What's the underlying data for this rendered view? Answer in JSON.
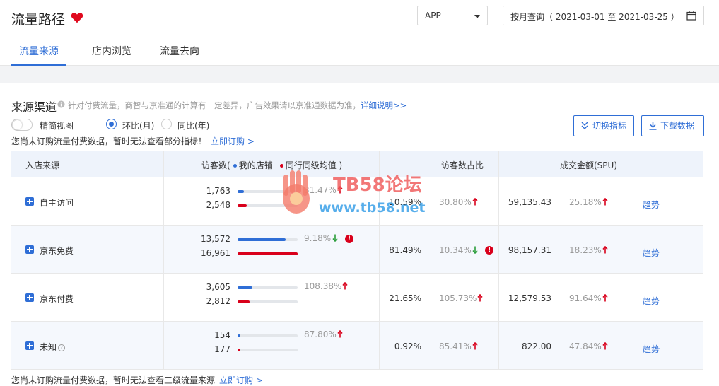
{
  "header": {
    "title": "流量路径",
    "platform_select": "APP",
    "date_range": "按月查询（ 2021-03-01 至 2021-03-25 ）",
    "tabs": [
      "流量来源",
      "店内浏览",
      "流量去向"
    ],
    "active_tab": 0
  },
  "section": {
    "title": "来源渠道",
    "note": "针对付费流量，商智与京准通的计算有一定差异，广告效果请以京准通数据为准，",
    "detail_link": "详细说明>>",
    "options": {
      "simple_view": "精简视图",
      "mom": "环比(月)",
      "yoy": "同比(年)",
      "selected": "mom"
    },
    "warning": "您尚未订购流量付费数据，暂时无法查看部分指标！",
    "subscribe_link": "立即订购 >",
    "buttons": {
      "switch_metric": "切换指标",
      "download": "下载数据"
    }
  },
  "table": {
    "headers": {
      "source": "入店来源",
      "visitors": "访客数(",
      "my_store": "我的店铺",
      "peer_avg": "同行同级均值 )",
      "visitor_share": "访客数占比",
      "gmv": "成交金额(SPU)"
    },
    "rows": [
      {
        "name": "自主访问",
        "help": false,
        "visitors_my": "1,763",
        "visitors_peer": "2,548",
        "bar_my_ratio": 0.104,
        "bar_peer_ratio": 0.15,
        "visitors_change": "31.47%",
        "visitors_dir": "up",
        "visitors_alert": false,
        "share": "10.59%",
        "share_change": "30.80%",
        "share_dir": "up",
        "share_alert": false,
        "gmv": "59,135.43",
        "gmv_change": "25.18%",
        "gmv_dir": "up",
        "trend": "趋势"
      },
      {
        "name": "京东免费",
        "help": false,
        "visitors_my": "13,572",
        "visitors_peer": "16,961",
        "bar_my_ratio": 0.8,
        "bar_peer_ratio": 1.0,
        "visitors_change": "9.18%",
        "visitors_dir": "down",
        "visitors_alert": true,
        "share": "81.49%",
        "share_change": "10.34%",
        "share_dir": "down",
        "share_alert": true,
        "gmv": "98,157.31",
        "gmv_change": "18.23%",
        "gmv_dir": "up",
        "trend": "趋势"
      },
      {
        "name": "京东付费",
        "help": false,
        "visitors_my": "3,605",
        "visitors_peer": "2,812",
        "bar_my_ratio": 0.25,
        "bar_peer_ratio": 0.2,
        "visitors_change": "108.38%",
        "visitors_dir": "up",
        "visitors_alert": false,
        "share": "21.65%",
        "share_change": "105.73%",
        "share_dir": "up",
        "share_alert": false,
        "gmv": "12,579.53",
        "gmv_change": "91.64%",
        "gmv_dir": "up",
        "trend": "趋势"
      },
      {
        "name": "未知",
        "help": true,
        "visitors_my": "154",
        "visitors_peer": "177",
        "bar_my_ratio": 0.04,
        "bar_peer_ratio": 0.05,
        "visitors_change": "87.80%",
        "visitors_dir": "up",
        "visitors_alert": false,
        "share": "0.92%",
        "share_change": "85.41%",
        "share_dir": "up",
        "share_alert": false,
        "gmv": "822.00",
        "gmv_change": "47.84%",
        "gmv_dir": "up",
        "trend": "趋势"
      }
    ]
  },
  "footer": {
    "note": "您尚未订购流量付费数据，暂时无法查看三级流量来源",
    "subscribe_link": "立即订购 >"
  },
  "watermark": {
    "line1": "TB58论坛",
    "line2": "www.tb58.net"
  },
  "colors": {
    "accent": "#2f6ed6",
    "peer": "#d9001b",
    "up": "#d9001b",
    "down": "#2a9d3a"
  }
}
